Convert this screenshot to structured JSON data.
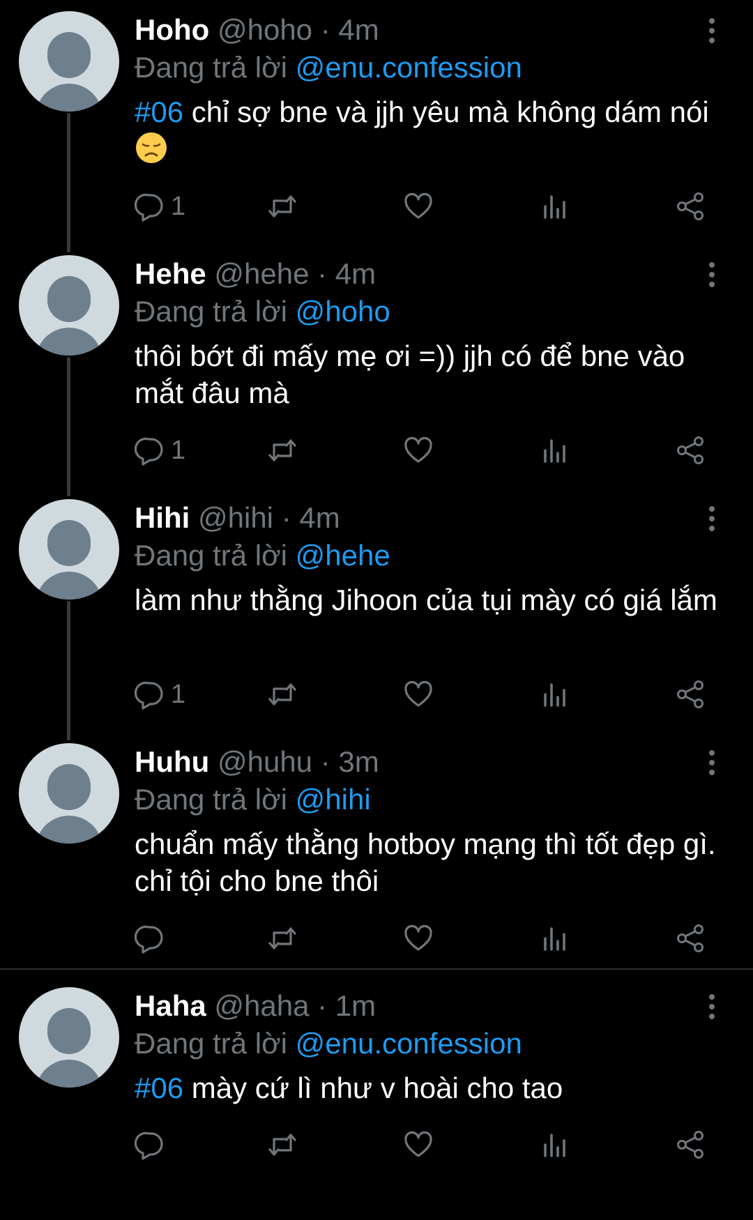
{
  "colors": {
    "background": "#000000",
    "text": "#ffffff",
    "muted": "#71767b",
    "accent": "#1d9bf0",
    "thread_line": "#343a40",
    "avatar_bg": "#cfd9de",
    "avatar_fg": "#6e7f8d"
  },
  "labels": {
    "replying_to": "Đang trả lời"
  },
  "tweets": [
    {
      "name": "Hoho",
      "handle": "@hoho",
      "separator": "·",
      "time": "4m",
      "reply_to": "@enu.confession",
      "hashtag": "#06",
      "text": " chỉ sợ bne và jjh yêu mà không dám nói ",
      "emoji": "disappointed-face-emoji",
      "reply_count": "1"
    },
    {
      "name": "Hehe",
      "handle": "@hehe",
      "separator": "·",
      "time": "4m",
      "reply_to": "@hoho",
      "text": "thôi bớt đi mấy mẹ ơi =)) jjh có để bne vào mắt đâu mà",
      "reply_count": "1"
    },
    {
      "name": "Hihi",
      "handle": "@hihi",
      "separator": "·",
      "time": "4m",
      "reply_to": "@hehe",
      "text": "làm như thằng Jihoon của tụi mày có giá lắm",
      "reply_count": "1"
    },
    {
      "name": "Huhu",
      "handle": "@huhu",
      "separator": "·",
      "time": "3m",
      "reply_to": "@hihi",
      "text": "chuẩn mấy thằng hotboy mạng thì tốt đẹp gì. chỉ tội cho bne thôi",
      "reply_count": ""
    },
    {
      "name": "Haha",
      "handle": "@haha",
      "separator": "·",
      "time": "1m",
      "reply_to": "@enu.confession",
      "hashtag": "#06",
      "text": " mày cứ lì như v hoài cho tao",
      "reply_count": ""
    }
  ],
  "icons": [
    "more-vertical-icon",
    "reply-icon",
    "retweet-icon",
    "like-icon",
    "views-icon",
    "share-icon"
  ]
}
